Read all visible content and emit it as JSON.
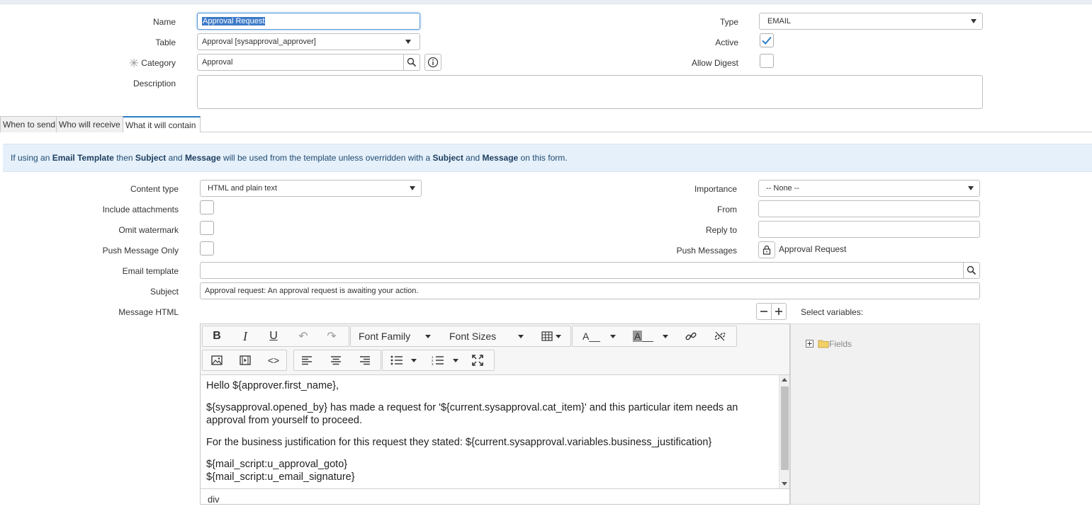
{
  "form": {
    "name_label": "Name",
    "name_value": "Approval Request",
    "table_label": "Table",
    "table_value": "Approval [sysapproval_approver]",
    "category_label": "Category",
    "category_value": "Approval",
    "description_label": "Description",
    "description_value": "",
    "type_label": "Type",
    "type_value": "EMAIL",
    "active_label": "Active",
    "active_checked": true,
    "allow_digest_label": "Allow Digest",
    "allow_digest_checked": false
  },
  "tabs": [
    {
      "label": "When to send",
      "active": false
    },
    {
      "label": "Who will receive",
      "active": false
    },
    {
      "label": "What it will contain",
      "active": true
    }
  ],
  "info": {
    "part1": "If using an ",
    "b1": "Email Template",
    "part2": " then ",
    "b2": "Subject",
    "part3": " and ",
    "b3": "Message",
    "part4": " will be used from the template unless overridden with a ",
    "b4": "Subject",
    "part5": " and ",
    "b5": "Message",
    "part6": " on this form."
  },
  "contain": {
    "content_type_label": "Content type",
    "content_type_value": "HTML and plain text",
    "include_attachments_label": "Include attachments",
    "omit_watermark_label": "Omit watermark",
    "push_message_only_label": "Push Message Only",
    "email_template_label": "Email template",
    "email_template_value": "",
    "subject_label": "Subject",
    "subject_value": "Approval request: An approval request is awaiting your action.",
    "message_html_label": "Message HTML",
    "importance_label": "Importance",
    "importance_value": "-- None --",
    "from_label": "From",
    "from_value": "",
    "reply_to_label": "Reply to",
    "reply_to_value": "",
    "push_messages_label": "Push Messages",
    "push_messages_value": "Approval Request",
    "select_variables_label": "Select variables:",
    "fields_node": "Fields"
  },
  "editor": {
    "font_family": "Font Family",
    "font_sizes": "Font Sizes",
    "text_color_glyph": "A__",
    "bg_color_glyph": "A",
    "lines": [
      "Hello ${approver.first_name},",
      "${sysapproval.opened_by} has made a request for '${current.sysapproval.cat_item}' and this particular item needs an approval from yourself to proceed.",
      "For the business justification for this request they stated: ${current.sysapproval.variables.business_justification}",
      "${mail_script:u_approval_goto}",
      "${mail_script:u_email_signature}"
    ],
    "status_path": "div"
  },
  "colors": {
    "accent": "#2d7ec8",
    "info_bg": "#e5f0fa",
    "selection": "#3d7ac7"
  }
}
